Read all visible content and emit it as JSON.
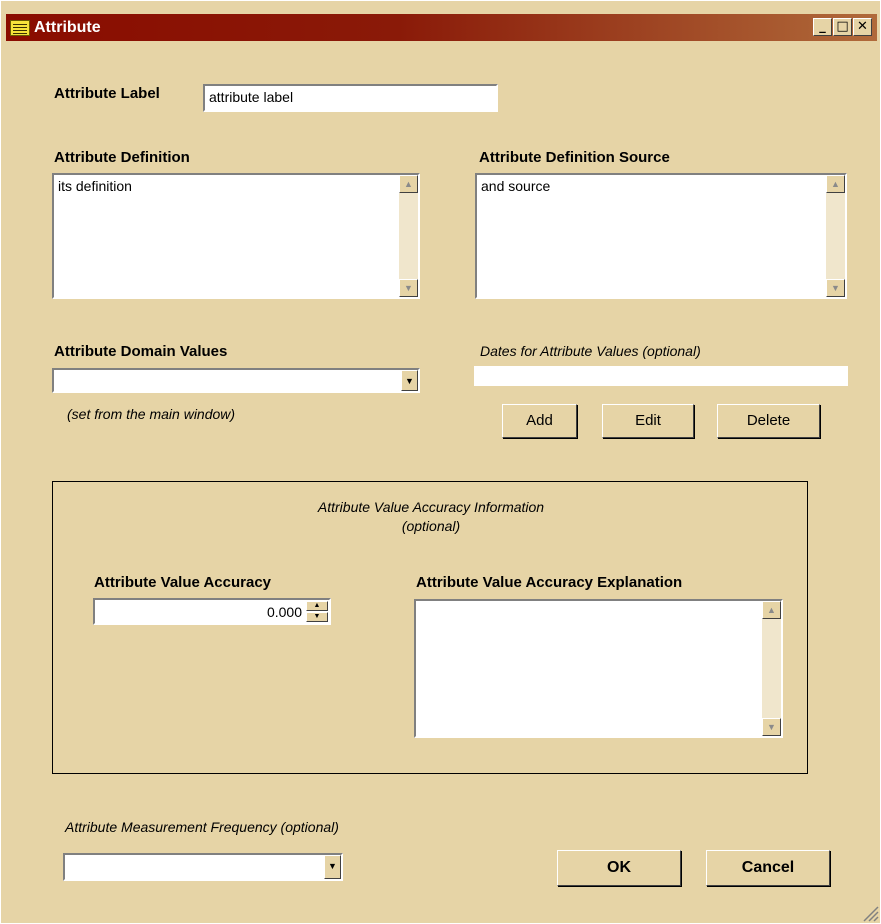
{
  "window": {
    "title": "Attribute",
    "minimize": "_",
    "maximize": "□",
    "close": "✕"
  },
  "attribute_label": {
    "label": "Attribute Label",
    "value": "attribute label"
  },
  "definition": {
    "label": "Attribute Definition",
    "value": "its definition"
  },
  "definition_source": {
    "label": "Attribute Definition Source",
    "value": "and source"
  },
  "domain_values": {
    "label": "Attribute Domain Values",
    "selected": "",
    "note": "(set from the main window)"
  },
  "dates": {
    "label": "Dates for Attribute Values (optional)",
    "value": ""
  },
  "date_buttons": {
    "add": "Add",
    "edit": "Edit",
    "delete": "Delete"
  },
  "accuracy_group": {
    "title_line1": "Attribute Value Accuracy Information",
    "title_line2": "(optional)",
    "accuracy_label": "Attribute Value Accuracy",
    "accuracy_value": "0.000",
    "explanation_label": "Attribute Value Accuracy Explanation",
    "explanation_value": ""
  },
  "frequency": {
    "label": "Attribute  Measurement  Frequency (optional)",
    "selected": ""
  },
  "actions": {
    "ok": "OK",
    "cancel": "Cancel"
  },
  "icons": {
    "window": "form-icon",
    "scroll_up": "scroll-up-arrow-icon",
    "scroll_down": "scroll-down-arrow-icon",
    "dropdown": "dropdown-arrow-icon",
    "resize": "resize-grip-icon"
  }
}
